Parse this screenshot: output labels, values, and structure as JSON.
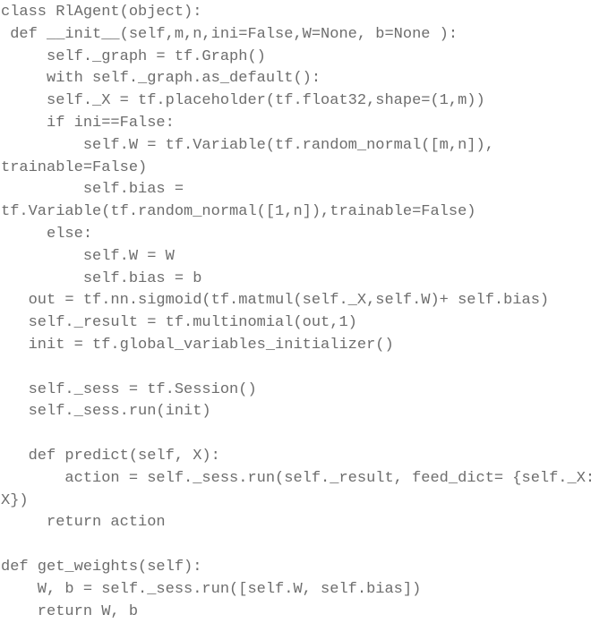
{
  "document": {
    "kind": "source-code-listing",
    "language": "Python",
    "background_color": "#ffffff",
    "text_color": "#6d6d6d",
    "lines": [
      "class RlAgent(object):",
      " def __init__(self,m,n,ini=False,W=None, b=None ):",
      "     self._graph = tf.Graph()",
      "     with self._graph.as_default():",
      "     self._X = tf.placeholder(tf.float32,shape=(1,m))",
      "     if ini==False:",
      "         self.W = tf.Variable(tf.random_normal([m,n]),",
      "trainable=False)",
      "         self.bias =",
      "tf.Variable(tf.random_normal([1,n]),trainable=False)",
      "     else:",
      "         self.W = W",
      "         self.bias = b",
      "   out = tf.nn.sigmoid(tf.matmul(self._X,self.W)+ self.bias)",
      "   self._result = tf.multinomial(out,1)",
      "   init = tf.global_variables_initializer()",
      "",
      "   self._sess = tf.Session()",
      "   self._sess.run(init)",
      "",
      "   def predict(self, X):",
      "       action = self._sess.run(self._result, feed_dict= {self._X:",
      "X})",
      "     return action",
      "",
      "def get_weights(self):",
      "    W, b = self._sess.run([self.W, self.bias])",
      "    return W, b"
    ]
  }
}
